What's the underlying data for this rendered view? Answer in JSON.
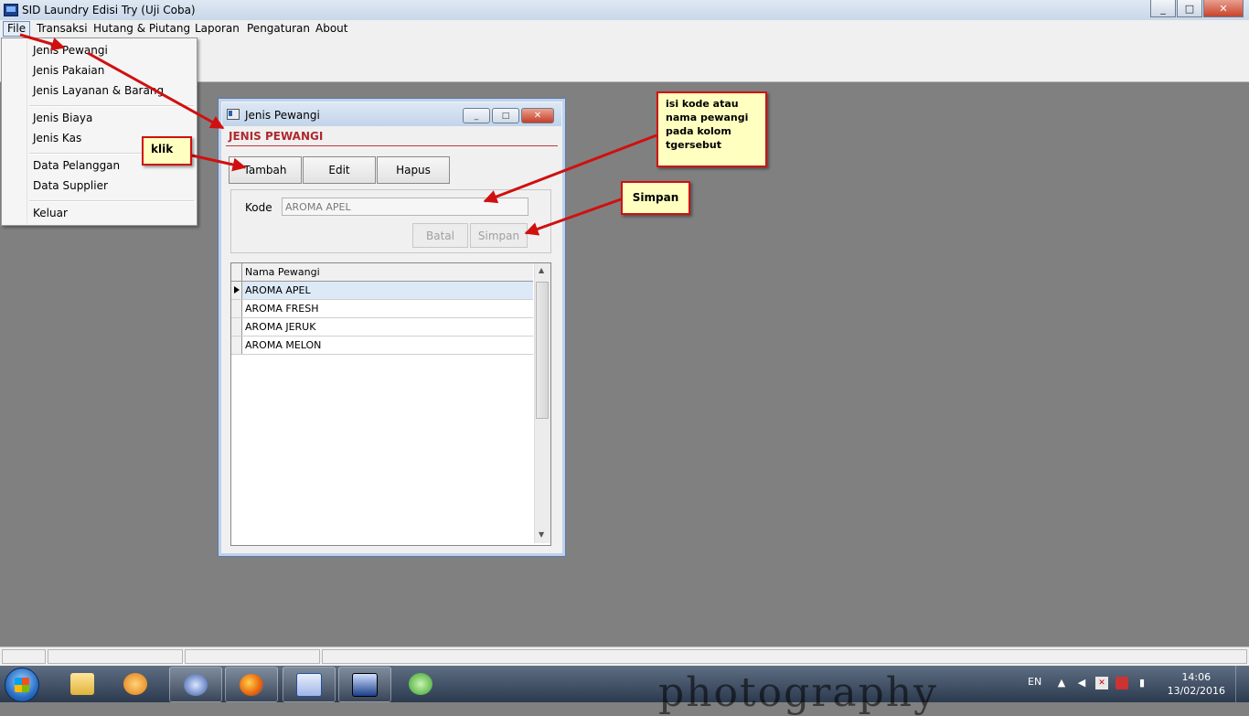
{
  "app": {
    "title": "SID Laundry Edisi Try (Uji Coba)"
  },
  "window_buttons": {
    "minimize": "_",
    "maximize": "□",
    "close": "✕"
  },
  "menubar": [
    "File",
    "Transaksi",
    "Hutang & Piutang",
    "Laporan",
    "Pengaturan",
    "About"
  ],
  "file_menu": {
    "items": [
      "Jenis Pewangi",
      "Jenis Pakaian",
      "Jenis Layanan & Barang",
      "Jenis Biaya",
      "Jenis Kas",
      "Data Pelanggan",
      "Data Supplier",
      "Keluar"
    ]
  },
  "child_window": {
    "title": "Jenis Pewangi",
    "heading": "JENIS PEWANGI",
    "buttons": {
      "tambah": "Tambah",
      "edit": "Edit",
      "hapus": "Hapus"
    },
    "form": {
      "kode_label": "Kode",
      "kode_value": "AROMA APEL",
      "batal": "Batal",
      "simpan": "Simpan"
    },
    "grid": {
      "column": "Nama Pewangi",
      "rows": [
        "AROMA APEL",
        "AROMA FRESH",
        "AROMA JERUK",
        "AROMA MELON"
      ],
      "selected_row": 0
    }
  },
  "annotations": {
    "klik": "klik",
    "isi_kode": [
      "isi kode atau",
      "nama pewangi",
      "pada kolom",
      "tgersebut"
    ],
    "simpan": "Simpan",
    "color": "#d01010"
  },
  "taskbar": {
    "language": "EN",
    "time": "14:06",
    "date": "13/02/2016"
  },
  "colors": {
    "heading": "#b0282e",
    "desktop": "#808080",
    "note_bg": "#ffffc0"
  }
}
